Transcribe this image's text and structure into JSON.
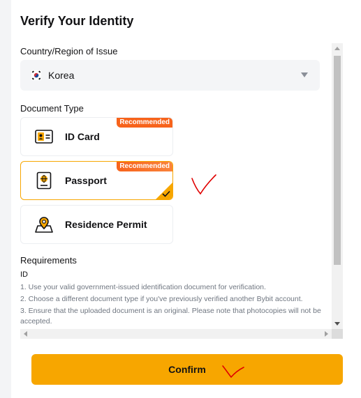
{
  "page": {
    "title": "Verify Your Identity"
  },
  "country": {
    "label": "Country/Region of Issue",
    "selected": "Korea",
    "flag_icon": "korea-flag-icon"
  },
  "document_type": {
    "label": "Document Type",
    "options": [
      {
        "label": "ID Card",
        "badge": "Recommended",
        "icon": "id-card-icon",
        "selected": false
      },
      {
        "label": "Passport",
        "badge": "Recommended",
        "icon": "passport-icon",
        "selected": true
      },
      {
        "label": "Residence Permit",
        "badge": "",
        "icon": "residence-permit-icon",
        "selected": false
      }
    ]
  },
  "requirements": {
    "label": "Requirements",
    "subheading": "ID",
    "items": [
      "1. Use your valid government-issued identification document for verification.",
      "2. Choose a different document type if you've previously verified another Bybit account.",
      "3. Ensure that the uploaded document is an original. Please note that photocopies will not be accepted."
    ]
  },
  "confirm_label": "Confirm",
  "colors": {
    "accent": "#f7a600",
    "badge": "#f7631b",
    "annotation": "#e00000"
  }
}
